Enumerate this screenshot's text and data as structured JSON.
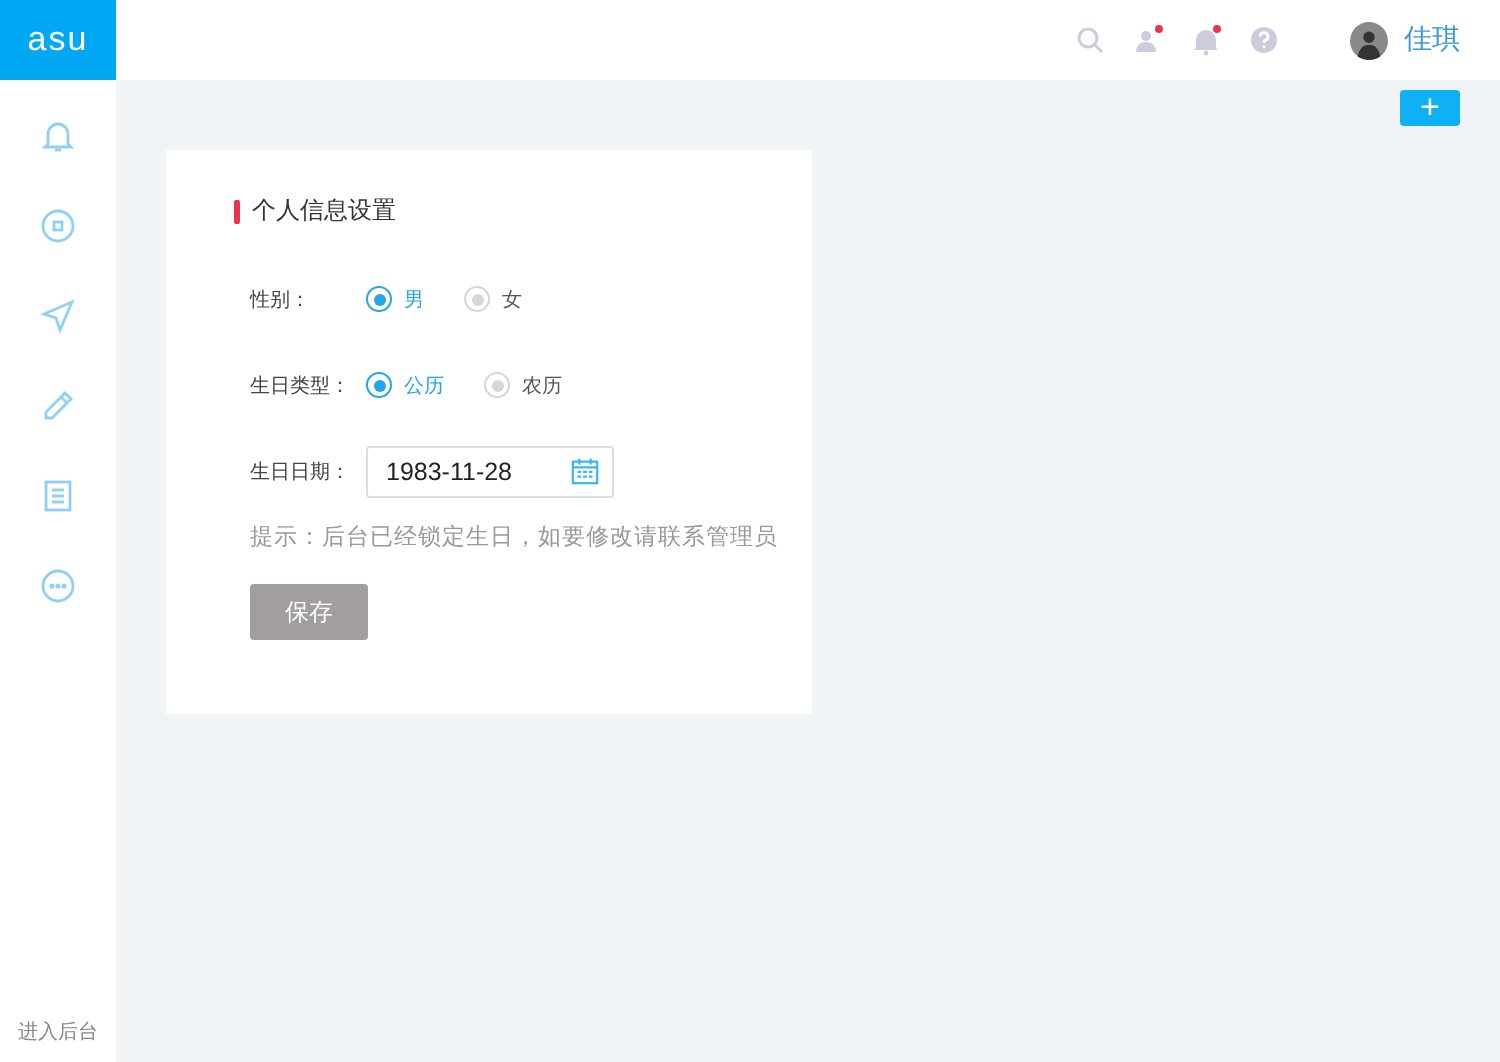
{
  "logo": "asu",
  "sidebar": {
    "footer": "进入后台"
  },
  "topbar": {
    "icons": [
      {
        "badge": false
      },
      {
        "badge": true
      },
      {
        "badge": true
      },
      {
        "badge": false
      }
    ],
    "user": "佳琪"
  },
  "add_button": "+",
  "card": {
    "title": "个人信息设置",
    "fields": [
      {
        "kind": "radio",
        "label": "性别：",
        "options": [
          {
            "label": "男",
            "selected": true
          },
          {
            "label": "女",
            "selected": false
          }
        ]
      },
      {
        "kind": "radio",
        "label": "生日类型：",
        "options": [
          {
            "label": "公历",
            "selected": true
          },
          {
            "label": "农历",
            "selected": false
          }
        ]
      },
      {
        "kind": "date",
        "label": "生日日期：",
        "value": "1983-11-28"
      }
    ],
    "hint": "提示：后台已经锁定生日，如要修改请联系管理员",
    "save_button": "保存"
  }
}
